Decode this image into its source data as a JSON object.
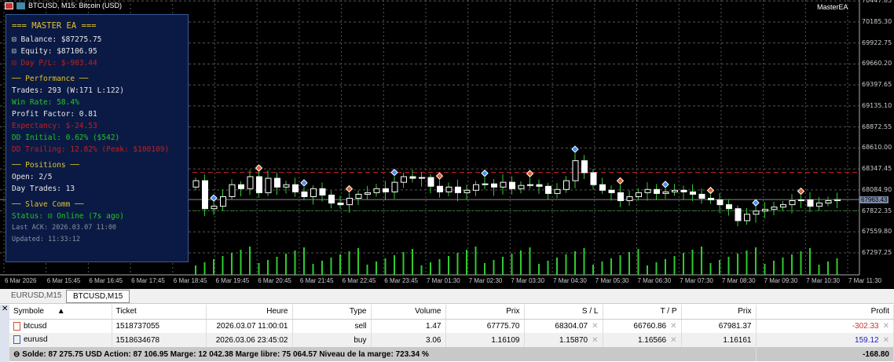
{
  "window": {
    "title": "BTCUSD, M15: Bitcoin (USD)",
    "ea_label": "MasterEA"
  },
  "panel": {
    "title": "=== MASTER EA ===",
    "balance": "⊡ Balance: $87275.75",
    "equity": "⊡ Equity: $87106.95",
    "day_pl": "⊡ Day P/L: $-903.44",
    "perf_header": "── Performance ──",
    "trades": "Trades: 293 (W:171 L:122)",
    "win_rate": "Win Rate: 58.4%",
    "profit_factor": "Profit Factor: 0.81",
    "expectancy": "Expectancy: $-24.53",
    "dd_initial": "DD Initial: 0.62%  ($542)",
    "dd_trailing": "DD Trailing: 12.82%  (Peak: $100109)",
    "pos_header": "── Positions ──",
    "open": "Open: 2/5",
    "day_trades": "Day Trades: 13",
    "slave_header": "── Slave Comm ──",
    "status": "Status: ⊡ Online (7s ago)",
    "last_ack": "Last ACK: 2026.03.07 11:00",
    "updated": "Updated: 11:33:12"
  },
  "price_scale": [
    "70447.85",
    "70185.30",
    "69922.75",
    "69660.20",
    "69397.65",
    "69135.10",
    "68872.55",
    "68610.00",
    "68347.45",
    "68084.90",
    "67822.35",
    "67559.80",
    "67297.25"
  ],
  "current_price": "67963.43",
  "time_labels": [
    "6 Mar 2026",
    "6 Mar 15:45",
    "6 Mar 16:45",
    "6 Mar 17:45",
    "6 Mar 18:45",
    "6 Mar 19:45",
    "6 Mar 20:45",
    "6 Mar 21:45",
    "6 Mar 22:45",
    "6 Mar 23:45",
    "7 Mar 01:30",
    "7 Mar 02:30",
    "7 Mar 03:30",
    "7 Mar 04:30",
    "7 Mar 05:30",
    "7 Mar 06:30",
    "7 Mar 07:30",
    "7 Mar 08:30",
    "7 Mar 09:30",
    "7 Mar 10:30",
    "7 Mar 11:30"
  ],
  "chart_data": {
    "type": "candlestick",
    "closes": [
      68200,
      67850,
      67880,
      68000,
      68150,
      68100,
      68250,
      68050,
      68230,
      68120,
      68150,
      68060,
      68000,
      68100,
      68020,
      67920,
      67900,
      67980,
      68030,
      68050,
      68100,
      68060,
      68180,
      68250,
      68230,
      68240,
      68130,
      68060,
      68120,
      68050,
      68080,
      68150,
      68160,
      68120,
      68180,
      68100,
      68140,
      68150,
      68130,
      68040,
      68090,
      68200,
      68450,
      68300,
      68150,
      68080,
      68050,
      67950,
      68000,
      68050,
      68090,
      68040,
      68060,
      68080,
      68060,
      68030,
      67980,
      67960,
      67900,
      67850,
      67700,
      67780,
      67820,
      67840,
      67870,
      67900,
      67950,
      67960,
      67880,
      67920,
      67950,
      67963
    ],
    "sl_line": 68304.07,
    "tp_line": 67822.35,
    "ylim": [
      67200,
      70447.85
    ]
  },
  "tabs": [
    "EURUSD,M15",
    "BTCUSD,M15"
  ],
  "table": {
    "headers": [
      "Symbole",
      "Ticket",
      "Heure",
      "Type",
      "Volume",
      "Prix",
      "S / L",
      "T / P",
      "Prix",
      "Profit"
    ],
    "rows": [
      {
        "symbol": "btcusd",
        "ticket": "1518737055",
        "time": "2026.03.07 11:00:01",
        "type": "sell",
        "volume": "1.47",
        "price": "67775.70",
        "sl": "68304.07",
        "tp": "66760.86",
        "cur": "67981.37",
        "profit": "-302.33",
        "color": "#d03030"
      },
      {
        "symbol": "eurusd",
        "ticket": "1518634678",
        "time": "2026.03.06 23:45:02",
        "type": "buy",
        "volume": "3.06",
        "price": "1.16109",
        "sl": "1.15870",
        "tp": "1.16566",
        "cur": "1.16161",
        "profit": "159.12",
        "color": "#2020d0"
      }
    ],
    "summary": "Solde: 87 275.75 USD  Action: 87 106.95  Marge: 12 042.38  Marge libre: 75 064.57  Niveau de la marge: 723.34 %",
    "total": "-168.80"
  }
}
